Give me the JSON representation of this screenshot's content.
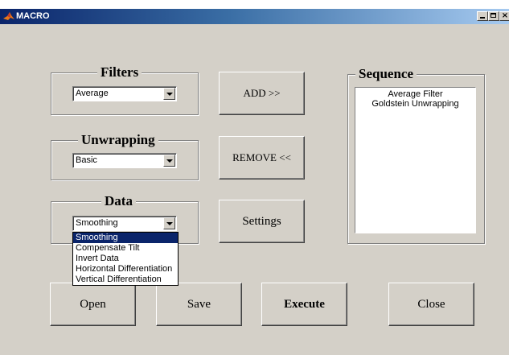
{
  "window": {
    "title": "MACRO"
  },
  "filters": {
    "title": "Filters",
    "selected": "Average"
  },
  "unwrapping": {
    "title": "Unwrapping",
    "selected": "Basic"
  },
  "data_group": {
    "title": "Data",
    "selected": "Smoothing",
    "options": [
      "Smoothing",
      "Compensate Tilt",
      "Invert Data",
      "Horizontal Differentiation",
      "Vertical Differentiation"
    ]
  },
  "buttons": {
    "add": "ADD >>",
    "remove": "REMOVE <<",
    "settings": "Settings",
    "open": "Open",
    "save": "Save",
    "execute": "Execute",
    "close": "Close"
  },
  "sequence": {
    "title": "Sequence",
    "items": [
      "Average Filter",
      "Goldstein Unwrapping"
    ]
  },
  "colors": {
    "titlebar_start": "#0a246a",
    "titlebar_end": "#a6caf0",
    "window_bg": "#d4d0c8",
    "selection": "#0a246a"
  }
}
